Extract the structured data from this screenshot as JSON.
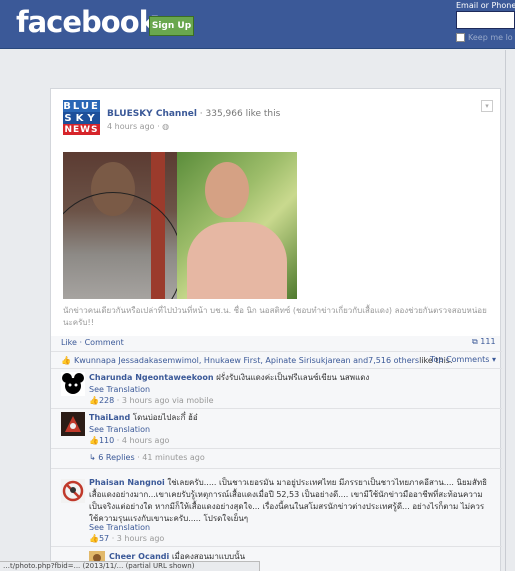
{
  "topbar": {
    "logo": "facebook",
    "signup_label": "Sign Up",
    "email_label": "Email or Phone",
    "keep_label": "Keep me lo"
  },
  "post": {
    "page_name": "BLUESKY Channel",
    "likes_text": " · 335,966 like this",
    "time": "4 hours ago · ",
    "logo_lines": [
      "BLUE",
      "SKY",
      "NEWS"
    ],
    "caption": "นักข่าวคนเดียวกันหรือเปล่าที่ไปป่วนที่หน้า บช.น. ชื่อ นิก นอสติทซ์ (ชอบทำข่าวเกี่ยวกับเสื้อแดง) ลองช่วยกันตรวจสอบหน่อยนะครับ!!"
  },
  "feedback": {
    "like": "Like",
    "comment": "Comment",
    "share_count": "111",
    "likers_prefix": "Kwunnapa Jessadakasemwimol, Hnukaew First, Apinate Sirisukjarean and ",
    "likers_others": "7,516 others",
    "likers_suffix": " like this.",
    "top_comments": "Top Comments ▾"
  },
  "comments": [
    {
      "name": "Charunda Ngeontaweekoon",
      "text": "ฝรั่งรับเงินแดงค่ะเป็นฟรีแลนซ์เขียน นสพแดง",
      "see_translation": "See Translation",
      "likes": "228",
      "time": " · 3 hours ago via mobile"
    },
    {
      "name": "ThaiLand",
      "text": "โดนบ่อยไปละกึ๋ ฮ้อ๋",
      "see_translation": "See Translation",
      "likes": "110",
      "time": " · 4 hours ago"
    },
    {
      "name": "Phaisan Nangnoi",
      "text": "ใช่เลยครับ..... เป็นชาวเยอรมัน มาอยู่ประเทศไทย มีภรรยาเป็นชาวไทยภาคอีสาน.... นิยมสัทธิเสื้อแดงอย่างมาก...เขาเคยรับรู้เหตุการณ์เสื้อแดงเมื่อปี 52,53 เป็นอย่างดี.... เขามีใช้นักข่าวมืออาชีพที่สะท้อนความเป็นจริงแต่อย่างใด หากมีก็ให้เสื้อแดงอย่างสุดใจ... เรื่องนี้คนในสโมสรนักข่าวต่างประเทศรู้ดี... อย่างไรก็ตาม ไม่ควรใช้ความรุนแรงกับเขานะครับ..... โปรดใจเย็นๆ",
      "see_translation": "See Translation",
      "likes": "57",
      "time": " · 3 hours ago"
    },
    {
      "name": "Cheer Ocandi",
      "text": " เมื่อคงสอนมาแบบนั้น"
    }
  ],
  "replies": {
    "label": "6 Replies",
    "time": " · 41 minutes ago"
  },
  "statusbar": "…t/photo.php?fbid=... (2013/11/... (partial URL shown)"
}
